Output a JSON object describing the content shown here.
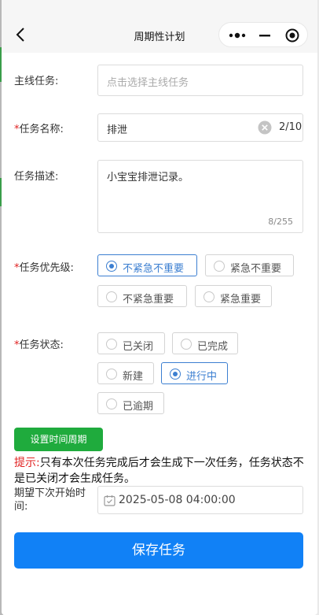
{
  "navbar": {
    "title": "周期性计划"
  },
  "form": {
    "main_task": {
      "label": "主线任务:",
      "placeholder": "点击选择主线任务"
    },
    "task_name": {
      "required_mark": "*",
      "label": "任务名称:",
      "value": "排泄",
      "counter": "2/10"
    },
    "task_desc": {
      "label": "任务描述:",
      "value": "小宝宝排泄记录。",
      "counter": "8/255"
    },
    "priority": {
      "required_mark": "*",
      "label": "任务优先级:",
      "options": [
        "不紧急不重要",
        "紧急不重要",
        "不紧急重要",
        "紧急重要"
      ],
      "selected": "不紧急不重要"
    },
    "status": {
      "required_mark": "*",
      "label": "任务状态:",
      "options": [
        "已关闭",
        "已完成",
        "新建",
        "进行中",
        "已逾期"
      ],
      "selected": "进行中"
    },
    "period_button": "设置时间周期",
    "tip": {
      "label": "提示:",
      "text": "只有本次任务完成后才会生成下一次任务，任务状态不是已关闭才会生成任务。"
    },
    "next_start": {
      "label": "期望下次开始时间:",
      "value": "2025-05-08 04:00:00"
    },
    "save_button": "保存任务"
  },
  "colors": {
    "accent": "#3c7fd1",
    "required": "#e02020",
    "period_button": "#1fab3d",
    "save_button": "#1181f6"
  },
  "icons": [
    "back-arrow-icon",
    "more-dots-icon",
    "minimize-icon",
    "close-circle-icon",
    "clear-icon",
    "calendar-icon"
  ]
}
